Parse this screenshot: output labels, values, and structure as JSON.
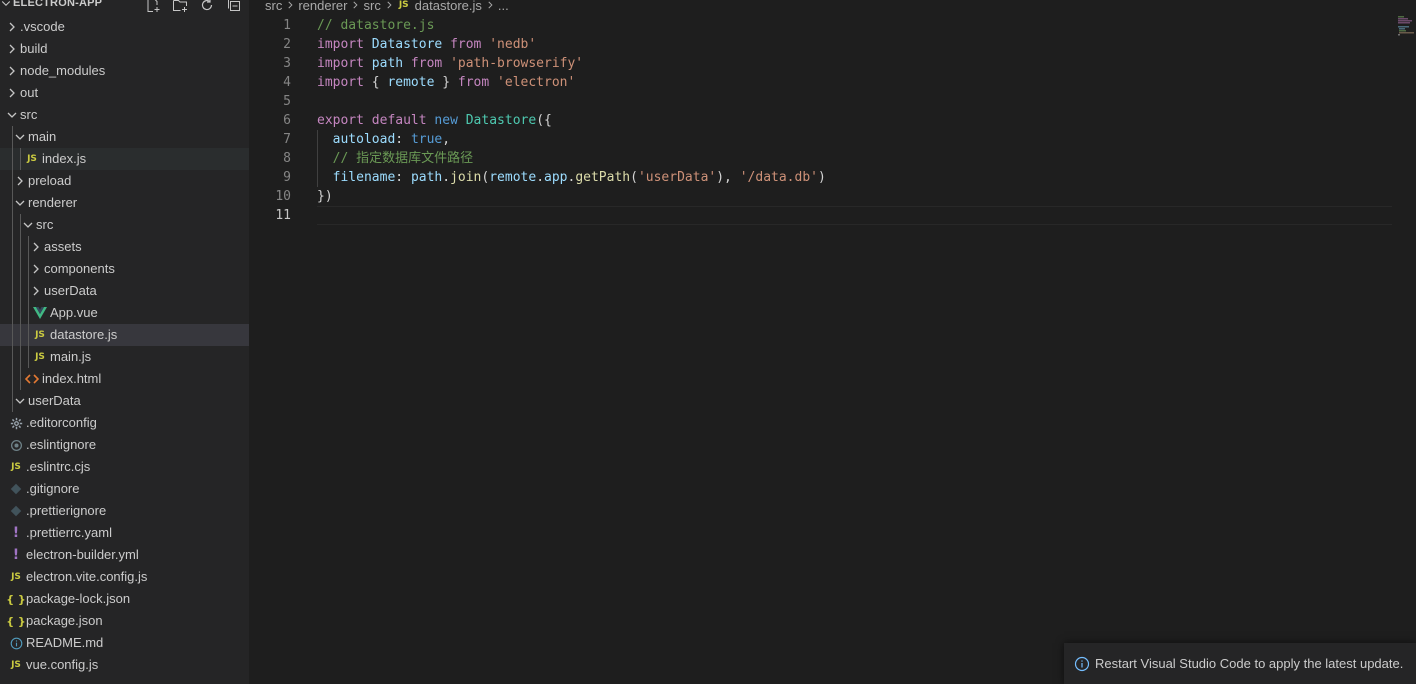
{
  "sidebar": {
    "title": "ELECTRON-APP",
    "header_actions": [
      {
        "name": "new-file-icon"
      },
      {
        "name": "new-folder-icon"
      },
      {
        "name": "refresh-icon"
      },
      {
        "name": "collapse-all-icon"
      }
    ],
    "tree": [
      {
        "label": ".vscode",
        "kind": "folder",
        "depth": 0,
        "open": false
      },
      {
        "label": "build",
        "kind": "folder",
        "depth": 0,
        "open": false
      },
      {
        "label": "node_modules",
        "kind": "folder",
        "depth": 0,
        "open": false
      },
      {
        "label": "out",
        "kind": "folder",
        "depth": 0,
        "open": false
      },
      {
        "label": "src",
        "kind": "folder",
        "depth": 0,
        "open": true
      },
      {
        "label": "main",
        "kind": "folder",
        "depth": 1,
        "open": true
      },
      {
        "label": "index.js",
        "kind": "js",
        "depth": 2
      },
      {
        "label": "preload",
        "kind": "folder",
        "depth": 1,
        "open": false
      },
      {
        "label": "renderer",
        "kind": "folder",
        "depth": 1,
        "open": true
      },
      {
        "label": "src",
        "kind": "folder",
        "depth": 2,
        "open": true
      },
      {
        "label": "assets",
        "kind": "folder",
        "depth": 3,
        "open": false
      },
      {
        "label": "components",
        "kind": "folder",
        "depth": 3,
        "open": false
      },
      {
        "label": "userData",
        "kind": "folder",
        "depth": 3,
        "open": false
      },
      {
        "label": "App.vue",
        "kind": "vue",
        "depth": 3
      },
      {
        "label": "datastore.js",
        "kind": "js",
        "depth": 3,
        "selected": true
      },
      {
        "label": "main.js",
        "kind": "js",
        "depth": 3
      },
      {
        "label": "index.html",
        "kind": "html",
        "depth": 2
      },
      {
        "label": "userData",
        "kind": "folder",
        "depth": 1,
        "open": true
      },
      {
        "label": ".editorconfig",
        "kind": "gear",
        "depth": 0
      },
      {
        "label": ".eslintignore",
        "kind": "eslint",
        "depth": 0
      },
      {
        "label": ".eslintrc.cjs",
        "kind": "js",
        "depth": 0
      },
      {
        "label": ".gitignore",
        "kind": "git",
        "depth": 0
      },
      {
        "label": ".prettierignore",
        "kind": "prettier",
        "depth": 0
      },
      {
        "label": ".prettierrc.yaml",
        "kind": "yaml",
        "depth": 0
      },
      {
        "label": "electron-builder.yml",
        "kind": "yaml",
        "depth": 0
      },
      {
        "label": "electron.vite.config.js",
        "kind": "js",
        "depth": 0
      },
      {
        "label": "package-lock.json",
        "kind": "json",
        "depth": 0
      },
      {
        "label": "package.json",
        "kind": "json",
        "depth": 0
      },
      {
        "label": "README.md",
        "kind": "info",
        "depth": 0
      },
      {
        "label": "vue.config.js",
        "kind": "js",
        "depth": 0
      }
    ],
    "badges": {
      "js": "JS",
      "json": "{ }",
      "yaml": "!"
    }
  },
  "breadcrumb": {
    "segments": [
      "src",
      "renderer",
      "src"
    ],
    "file_badge": "JS",
    "file": "datastore.js",
    "trailing": "..."
  },
  "editor": {
    "current_line": 11,
    "lines": [
      {
        "n": "1",
        "tokens": [
          {
            "t": "// datastore.js",
            "c": "cmt"
          }
        ]
      },
      {
        "n": "2",
        "tokens": [
          {
            "t": "import ",
            "c": "kw"
          },
          {
            "t": "Datastore",
            "c": "var"
          },
          {
            "t": " from ",
            "c": "kw"
          },
          {
            "t": "'nedb'",
            "c": "str"
          }
        ]
      },
      {
        "n": "3",
        "tokens": [
          {
            "t": "import ",
            "c": "kw"
          },
          {
            "t": "path",
            "c": "var"
          },
          {
            "t": " from ",
            "c": "kw"
          },
          {
            "t": "'path-browserify'",
            "c": "str"
          }
        ]
      },
      {
        "n": "4",
        "tokens": [
          {
            "t": "import ",
            "c": "kw"
          },
          {
            "t": "{ ",
            "c": "pun"
          },
          {
            "t": "remote",
            "c": "var"
          },
          {
            "t": " } ",
            "c": "pun"
          },
          {
            "t": "from ",
            "c": "kw"
          },
          {
            "t": "'electron'",
            "c": "str"
          }
        ]
      },
      {
        "n": "5",
        "tokens": []
      },
      {
        "n": "6",
        "tokens": [
          {
            "t": "export ",
            "c": "kw"
          },
          {
            "t": "default ",
            "c": "kw"
          },
          {
            "t": "new ",
            "c": "kw2"
          },
          {
            "t": "Datastore",
            "c": "cls"
          },
          {
            "t": "({",
            "c": "pun"
          }
        ]
      },
      {
        "n": "7",
        "tokens": [
          {
            "t": "  ",
            "c": "pun"
          },
          {
            "t": "autoload",
            "c": "var"
          },
          {
            "t": ": ",
            "c": "pun"
          },
          {
            "t": "true",
            "c": "kw2"
          },
          {
            "t": ",",
            "c": "pun"
          }
        ]
      },
      {
        "n": "8",
        "tokens": [
          {
            "t": "  ",
            "c": "pun"
          },
          {
            "t": "// 指定数据库文件路径",
            "c": "cmt"
          }
        ]
      },
      {
        "n": "9",
        "tokens": [
          {
            "t": "  ",
            "c": "pun"
          },
          {
            "t": "filename",
            "c": "var"
          },
          {
            "t": ": ",
            "c": "pun"
          },
          {
            "t": "path",
            "c": "var"
          },
          {
            "t": ".",
            "c": "pun"
          },
          {
            "t": "join",
            "c": "fn"
          },
          {
            "t": "(",
            "c": "pun"
          },
          {
            "t": "remote",
            "c": "var"
          },
          {
            "t": ".",
            "c": "pun"
          },
          {
            "t": "app",
            "c": "var"
          },
          {
            "t": ".",
            "c": "pun"
          },
          {
            "t": "getPath",
            "c": "fn"
          },
          {
            "t": "(",
            "c": "pun"
          },
          {
            "t": "'userData'",
            "c": "str"
          },
          {
            "t": "), ",
            "c": "pun"
          },
          {
            "t": "'/data.db'",
            "c": "str"
          },
          {
            "t": ")",
            "c": "pun"
          }
        ]
      },
      {
        "n": "10",
        "tokens": [
          {
            "t": "})",
            "c": "pun"
          }
        ]
      },
      {
        "n": "11",
        "tokens": []
      }
    ]
  },
  "notification": {
    "icon": "info-icon",
    "message": "Restart Visual Studio Code to apply the latest update."
  },
  "colors": {
    "sidebar_bg": "#252526",
    "editor_bg": "#1e1e1e",
    "selected_row": "#37373d",
    "js_badge": "#cbcb41",
    "vue_green": "#41b883",
    "html_orange": "#e37933",
    "yaml_purple": "#a074c4",
    "json_yellow": "#cbcb41",
    "info_blue": "#519aba",
    "git_gray": "#41535b"
  }
}
